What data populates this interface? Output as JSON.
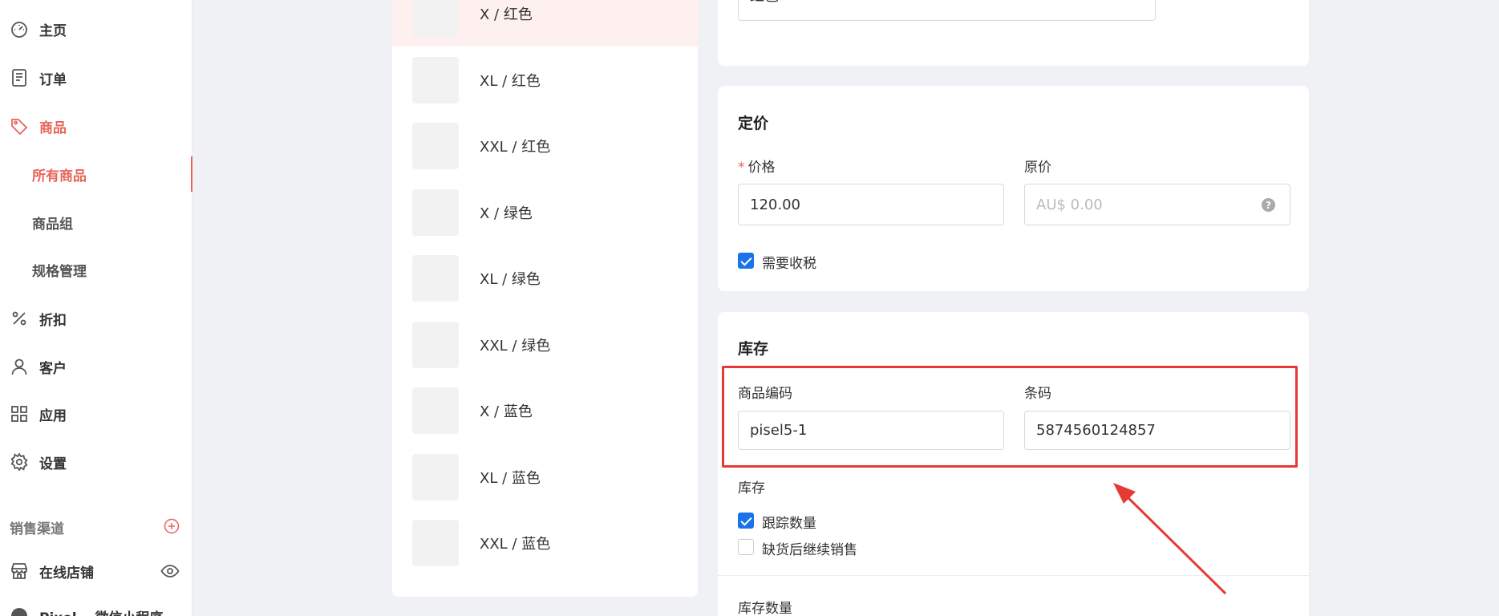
{
  "sidebar": {
    "items": [
      {
        "label": "主页",
        "icon": "dashboard-icon"
      },
      {
        "label": "订单",
        "icon": "order-icon"
      },
      {
        "label": "商品",
        "icon": "tag-icon"
      },
      {
        "label": "折扣",
        "icon": "percent-icon"
      },
      {
        "label": "客户",
        "icon": "user-icon"
      },
      {
        "label": "应用",
        "icon": "apps-icon"
      },
      {
        "label": "设置",
        "icon": "gear-icon"
      }
    ],
    "sub_items": [
      {
        "label": "所有商品"
      },
      {
        "label": "商品组"
      },
      {
        "label": "规格管理"
      }
    ],
    "sales_channels_label": "销售渠道",
    "channel": {
      "label": "在线店铺"
    },
    "next_channel": {
      "label": "Pixel… 微信小程序"
    }
  },
  "variants": [
    {
      "label": "X / 红色"
    },
    {
      "label": "XL / 红色"
    },
    {
      "label": "XXL / 红色"
    },
    {
      "label": "X / 绿色"
    },
    {
      "label": "XL / 绿色"
    },
    {
      "label": "XXL / 绿色"
    },
    {
      "label": "X / 蓝色"
    },
    {
      "label": "XL / 蓝色"
    },
    {
      "label": "XXL / 蓝色"
    }
  ],
  "option_card": {
    "color_value": "红色"
  },
  "pricing": {
    "title": "定价",
    "price_label": "价格",
    "price_required_mark": "*",
    "price_value": "120.00",
    "original_label": "原价",
    "original_placeholder": "AU$ 0.00",
    "help_mark": "?",
    "taxable_label": "需要收税"
  },
  "inventory": {
    "title": "库存",
    "sku_label": "商品编码",
    "sku_value": "pisel5-1",
    "barcode_label": "条码",
    "barcode_value": "5874560124857",
    "stock_label": "库存",
    "track_label": "跟踪数量",
    "continue_label": "缺货后继续销售",
    "quantity_label": "库存数量"
  },
  "colors": {
    "accent": "#e8645a",
    "checkbox": "#1a73e8",
    "highlight": "#e53935"
  }
}
